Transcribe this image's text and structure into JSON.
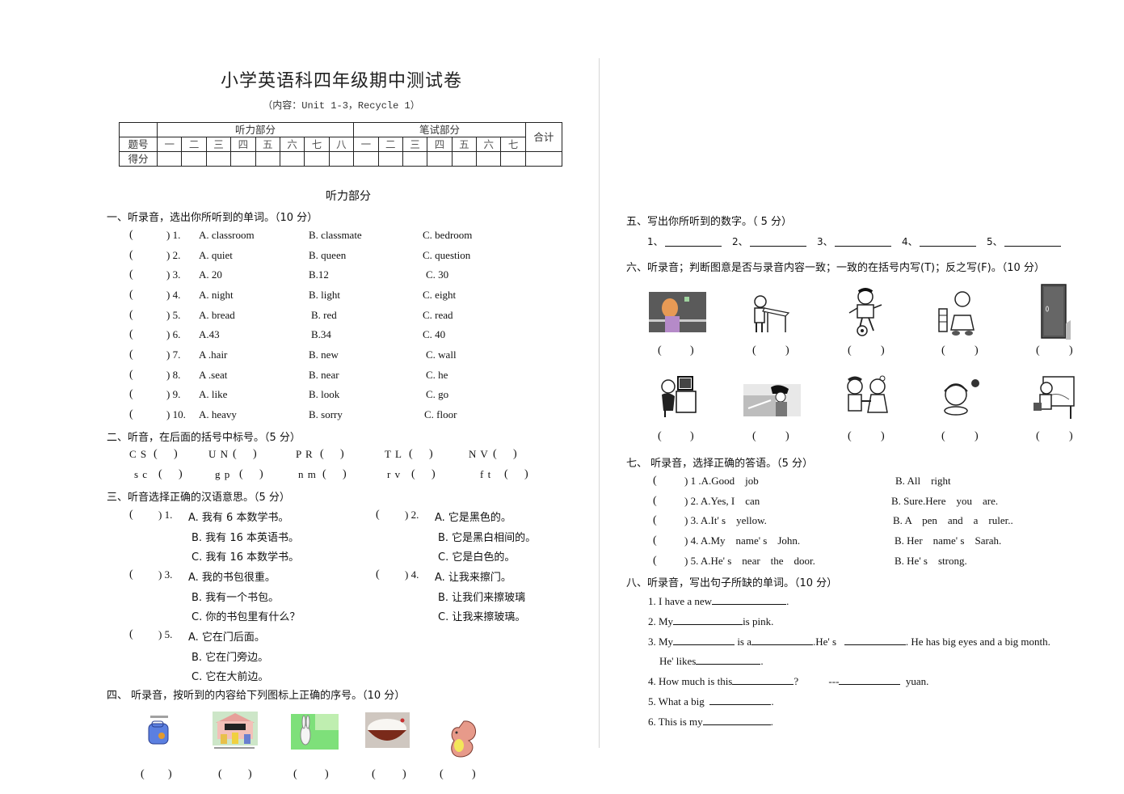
{
  "header": {
    "title": "小学英语科四年级期中测试卷",
    "subtitle": "（内容：Unit 1-3，Recycle 1）"
  },
  "score_table": {
    "listening_label": "听力部分",
    "written_label": "笔试部分",
    "total_label": "合计",
    "row_number_label": "题号",
    "row_score_label": "得分",
    "listening_cols": [
      "一",
      "二",
      "三",
      "四",
      "五",
      "六",
      "七",
      "八"
    ],
    "written_cols": [
      "一",
      "二",
      "三",
      "四",
      "五",
      "六",
      "七"
    ]
  },
  "listening_heading": "听力部分",
  "s1": {
    "heading": "一、听录音，选出你所听到的单词。（10 分）",
    "items": [
      {
        "num": ") 1.",
        "a": "A. classroom",
        "b": "B. classmate",
        "c": "C. bedroom"
      },
      {
        "num": ") 2.",
        "a": "A. quiet",
        "b": "B. queen",
        "c": "C. question"
      },
      {
        "num": ") 3.",
        "a": "A. 20",
        "b": "B.12",
        "c": "C. 30"
      },
      {
        "num": ") 4.",
        "a": "A. night",
        "b": "B. light",
        "c": "C. eight"
      },
      {
        "num": ") 5.",
        "a": "A. bread",
        "b": "B. red",
        "c": "C. read"
      },
      {
        "num": ") 6.",
        "a": "A.43",
        "b": "B.34",
        "c": "C. 40"
      },
      {
        "num": ") 7.",
        "a": "A .hair",
        "b": "B. new",
        "c": "C. wall"
      },
      {
        "num": ") 8.",
        "a": "A .seat",
        "b": "B. near",
        "c": "C. he"
      },
      {
        "num": ") 9.",
        "a": "A. like",
        "b": "B. look",
        "c": "C. go"
      },
      {
        "num": ") 10.",
        "a": "A. heavy",
        "b": "B. sorry",
        "c": "C. floor"
      }
    ]
  },
  "s2": {
    "heading": "二、听音，在后面的括号中标号。（5 分）",
    "row1": [
      "C S",
      "U N",
      "P R",
      "T L",
      "N V"
    ],
    "row2": [
      "s c",
      "g p",
      "n m",
      "r v",
      "f t"
    ]
  },
  "s3": {
    "heading": "三、听音选择正确的汉语意思。（5 分）",
    "items": [
      {
        "num": ") 1.",
        "options": [
          "A.  我有 6 本数学书。",
          "B.  我有 16 本英语书。",
          "C.  我有 16 本数学书。"
        ]
      },
      {
        "num": ") 2.",
        "options": [
          "A.  它是黑色的。",
          "B.  它是黑白相间的。",
          "C.  它是白色的。"
        ]
      },
      {
        "num": ") 3.",
        "options": [
          "A.  我的书包很重。",
          "B.  我有一个书包。",
          "C.  你的书包里有什么？"
        ]
      },
      {
        "num": ") 4.",
        "options": [
          "A.  让我来擦门。",
          "B.  让我们来擦玻璃",
          "C.  让我来擦玻璃。"
        ]
      },
      {
        "num": ") 5.",
        "options": [
          "A.  它在门后面。",
          "B.  它在门旁边。",
          "C.  它在大前边。"
        ]
      }
    ]
  },
  "s4": {
    "heading": "四、  听录音，按听到的内容给下列图标上正确的序号。（10 分）",
    "pictures": [
      "schoolbag",
      "classroom",
      "rabbit",
      "bowl-of-rice",
      "squirrel"
    ]
  },
  "s5": {
    "heading": "五、写出你所听到的数字。（ 5 分）",
    "labels": [
      "1、",
      "2、",
      "3、",
      "4、",
      "5、"
    ]
  },
  "s6": {
    "heading": "六、听录音；判断图意是否与录音内容一致；一致的在括号内写(T)；反之写(F)。（10 分）",
    "row1": [
      "girl-cleaning-blackboard",
      "boy-cleaning-desk",
      "boy-playing-football",
      "girl-near-chair",
      "door"
    ],
    "row2": [
      "girl-at-computer",
      "boy-cleaning-window",
      "two-children-shaking-hands",
      "girl-eating",
      "boy-painting-picture"
    ]
  },
  "s7": {
    "heading": "七、  听录音，选择正确的答语。（5 分）",
    "items": [
      {
        "a": ") 1 .A.Good    job",
        "b": "B. All    right"
      },
      {
        "a": ") 2. A.Yes, I    can",
        "b": "B. Sure.Here    you    are."
      },
      {
        "a": ") 3. A.It' s    yellow.",
        "b": "B. A    pen    and    a    ruler.."
      },
      {
        "a": ") 4. A.My    name' s    John.",
        "b": "B. Her    name' s    Sarah."
      },
      {
        "a": ") 5. A.He' s    near    the    door.",
        "b": "B. He' s    strong."
      }
    ]
  },
  "s8": {
    "heading": "八、听录音，写出句子所缺的单词。（10 分）",
    "l1a": "1. I have a new",
    "l1b": ".",
    "l2a": "2. My",
    "l2b": "is pink.",
    "l3a": "3. My",
    "l3b": "is a",
    "l3c": ".He' s",
    "l3d": ". He has big eyes and a big month.",
    "l3e": "He' likes",
    "l3f": ".",
    "l4a": "4. How much is this",
    "l4b": "?",
    "l4c": "---",
    "l4d": "yuan.",
    "l5a": "5. What a big",
    "l5b": ".",
    "l6a": "6. This is my",
    "l6b": "."
  },
  "paren_open": "(",
  "paren_close": ")"
}
